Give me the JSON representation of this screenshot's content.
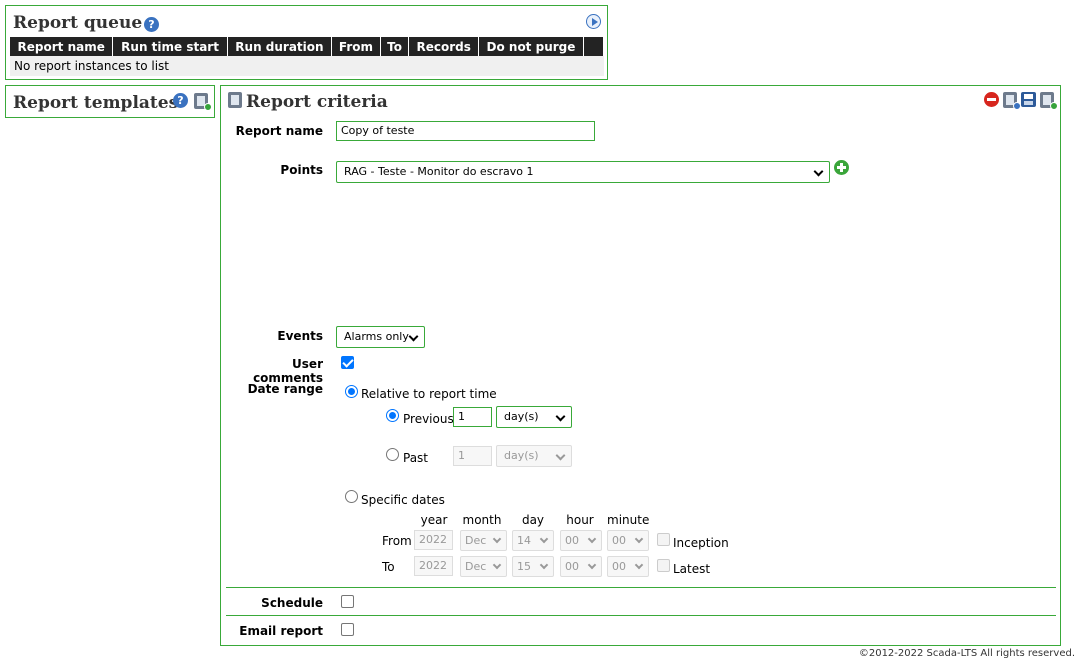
{
  "report_queue": {
    "title": "Report queue",
    "help_glyph": "?",
    "columns": [
      "Report name",
      "Run time start",
      "Run duration",
      "From",
      "To",
      "Records",
      "Do not purge"
    ],
    "empty_message": "No report instances to list"
  },
  "report_templates": {
    "title": "Report templates",
    "help_glyph": "?"
  },
  "criteria": {
    "title": "Report criteria",
    "report_name_label": "Report name",
    "report_name_value": "Copy of teste",
    "points_label": "Points",
    "points_selected": "RAG - Teste - Monitor do escravo 1",
    "events_label": "Events",
    "events_selected": "Alarms only",
    "user_comments_label": "User comments",
    "date_range_label": "Date range",
    "relative_label": "Relative to report time",
    "previous_label": "Previous",
    "previous_value": "1",
    "previous_unit": "day(s)",
    "past_label": "Past",
    "past_value": "1",
    "past_unit": "day(s)",
    "specific_dates_label": "Specific dates",
    "date_headers": {
      "year": "year",
      "month": "month",
      "day": "day",
      "hour": "hour",
      "minute": "minute"
    },
    "from_label": "From",
    "from": {
      "year": "2022",
      "month": "Dec",
      "day": "14",
      "hour": "00",
      "minute": "00"
    },
    "inception_label": "Inception",
    "to_label": "To",
    "to": {
      "year": "2022",
      "month": "Dec",
      "day": "15",
      "hour": "00",
      "minute": "00"
    },
    "latest_label": "Latest",
    "schedule_label": "Schedule",
    "email_label": "Email report"
  },
  "footer": "©2012-2022 Scada-LTS All rights reserved.",
  "colors": {
    "border_green": "#39a939",
    "header_dark": "#232323",
    "check_blue": "#0075ff"
  }
}
